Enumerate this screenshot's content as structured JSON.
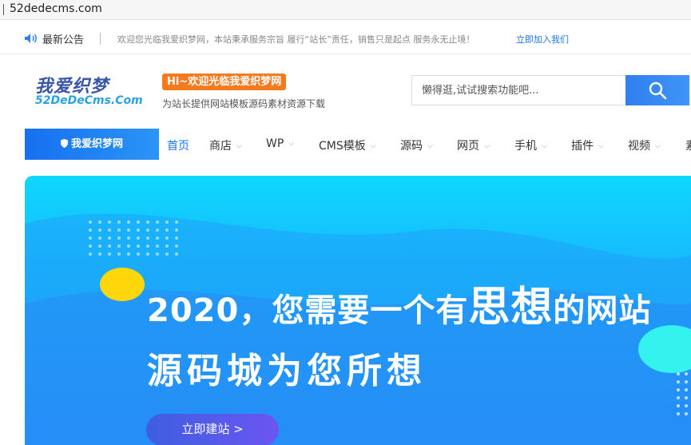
{
  "browser": {
    "url": "52dedecms.com"
  },
  "notice": {
    "title": "最新公告",
    "message": "欢迎您光临我爱织梦网，本站秉承服务宗旨 履行“站长”责任，销售只是起点 服务永无止境！",
    "join_link": "立即加入我们"
  },
  "header": {
    "logo_cn": "我爱织梦",
    "logo_en": "52DeDeCms.Com",
    "badge": "Hi~欢迎光临我爱织梦网",
    "tagline": "为站长提供网站模板源码素材资源下载"
  },
  "search": {
    "placeholder": "懒得逛,试试搜索功能吧..."
  },
  "nav": {
    "brand": "我爱织梦网",
    "items": [
      {
        "label": "首页"
      },
      {
        "label": "商店"
      },
      {
        "label": "WP"
      },
      {
        "label": "CMS模板"
      },
      {
        "label": "源码"
      },
      {
        "label": "网页"
      },
      {
        "label": "手机"
      },
      {
        "label": "插件"
      },
      {
        "label": "视频"
      },
      {
        "label": "素"
      }
    ]
  },
  "banner": {
    "headline_pre": "2020，您需要一个有",
    "headline_emph": "思想",
    "headline_post": "的网站",
    "subline": "源码城为您所想",
    "cta": "立即建站 >"
  },
  "colors": {
    "accent": "#1a73e8",
    "badge": "#f47a20",
    "banner_top": "#0fd7ff",
    "banner_bottom": "#2688f8"
  },
  "icons": {
    "notice": "speaker-icon",
    "search": "search-icon",
    "brand": "shield-icon"
  }
}
